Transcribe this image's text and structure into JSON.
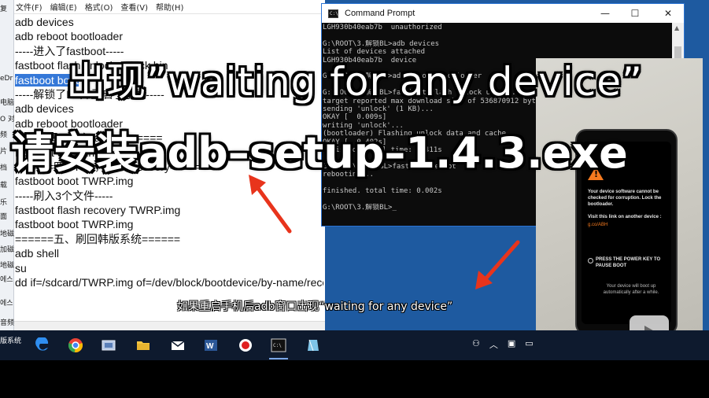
{
  "left_strip": {
    "items": [
      "复",
      "eDr",
      "电脑",
      "O 对",
      "频",
      "片",
      "档",
      "载",
      "乐",
      "面",
      "地磁",
      "加磁",
      "地磁",
      "에스",
      "에스",
      "音频",
      "版系统"
    ]
  },
  "notepad": {
    "menu": [
      "文件(F)",
      "编辑(E)",
      "格式(O)",
      "查看(V)",
      "帮助(H)"
    ],
    "lines": [
      "adb devices",
      "adb reboot bootloader",
      "-----进入了fastboot-----",
      "fastboot flash unlock unlock.bin",
      "fastboot boot",
      "-----解锁了BL并重启了手机-----",
      "adb devices",
      "adb reboot bootloader",
      "=====四、进入fastboot=====",
      "fastboot oem-unlock",
      "======四、root，刷入recovery======",
      "fastboot boot TWRP.img",
      "-----刷入3个文件-----",
      "fastboot flash recovery TWRP.img",
      "fastboot boot TWRP.img",
      "======五、刷回韩版系统======",
      "adb shell",
      "su",
      "dd if=/sdcard/TWRP.img of=/dev/block/bootdevice/by-name/recovery"
    ],
    "selected_line_index": 4
  },
  "cmd": {
    "title": "Command Prompt",
    "controls": {
      "minimize": "—",
      "maximize": "☐",
      "close": "✕"
    },
    "lines": [
      "LGH930b40eab7b  unauthorized",
      "",
      "G:\\ROOT\\3.解锁BL>adb devices",
      "List of devices attached",
      "LGH930b40eab7b  device",
      "",
      "G:\\ROOT\\3.解锁BL>adb reboot bootloader",
      "",
      "G:\\ROOT\\3.解锁BL>fastboot flash unlock unlock.bin",
      "target reported max download size of 536870912 bytes",
      "sending 'unlock' (1 KB)...",
      "OKAY [  0.009s]",
      "writing 'unlock'...",
      "(bootloader) Flashing unlock data and cache...",
      "OKAY [  0.402s]",
      "finished. total time: 0.411s",
      "",
      "G:\\ROOT\\3.解锁BL>fastboot reboot",
      "rebooting...",
      "",
      "finished. total time: 0.002s",
      "",
      "G:\\ROOT\\3.解锁BL>_"
    ]
  },
  "phone": {
    "warning_icon": "warning-triangle-icon",
    "text1": "Your device software cannot be checked for corruption. Lock the bootloader.",
    "text2": "Visit this link on another device :",
    "link": "g.co/ABH",
    "text3": "PRESS THE POWER KEY TO PAUSE BOOT",
    "text4": "Your device will boot up automatically after a while."
  },
  "captions": {
    "line1": "出现”waiting for any device”",
    "line2": "请安装adb–setup–1.4.3.exe",
    "subtitle": "如果重启手机后adb窗口出现“waiting for any device”"
  },
  "taskbar": {
    "start_label": "版系统",
    "apps": [
      "edge-icon",
      "chrome-icon",
      "media-icon",
      "folder-icon",
      "mail-icon",
      "word-icon",
      "record-icon",
      "cmd-icon",
      "app-icon"
    ],
    "active_app": "cmd-icon",
    "tray": [
      "people-icon",
      "chevron-up-icon",
      "network-icon",
      "display-icon"
    ]
  },
  "colors": {
    "arrow_red": "#e8341c",
    "selection_blue": "#3578d8",
    "phone_warning_orange": "#f57a1f"
  }
}
